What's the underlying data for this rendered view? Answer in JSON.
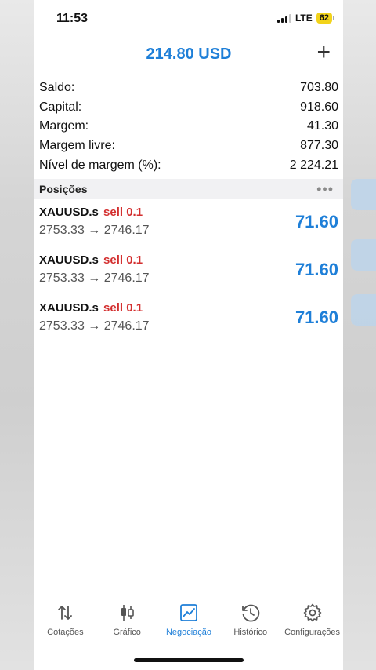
{
  "status_bar": {
    "time": "11:53",
    "network": "LTE",
    "battery": "62"
  },
  "header": {
    "title": "214.80 USD",
    "add_label": "+"
  },
  "summary": [
    {
      "label": "Saldo:",
      "value": "703.80"
    },
    {
      "label": "Capital:",
      "value": "918.60"
    },
    {
      "label": "Margem:",
      "value": "41.30"
    },
    {
      "label": "Margem livre:",
      "value": "877.30"
    },
    {
      "label": "Nível de margem (%):",
      "value": "2 224.21"
    }
  ],
  "positions_section": {
    "title": "Posições",
    "menu": "•••"
  },
  "positions": [
    {
      "symbol": "XAUUSD.s",
      "side": "sell 0.1",
      "prices": "2753.33 → 2746.17",
      "profit": "71.60"
    },
    {
      "symbol": "XAUUSD.s",
      "side": "sell 0.1",
      "prices": "2753.33 → 2746.17",
      "profit": "71.60"
    },
    {
      "symbol": "XAUUSD.s",
      "side": "sell 0.1",
      "prices": "2753.33 → 2746.17",
      "profit": "71.60"
    }
  ],
  "tabs": [
    {
      "label": "Cotações",
      "icon": "quotes-arrows-icon",
      "active": false
    },
    {
      "label": "Gráfico",
      "icon": "candlestick-chart-icon",
      "active": false
    },
    {
      "label": "Negociação",
      "icon": "trade-chart-icon",
      "active": true
    },
    {
      "label": "Histórico",
      "icon": "history-clock-icon",
      "active": false
    },
    {
      "label": "Configurações",
      "icon": "settings-gear-icon",
      "active": false
    }
  ],
  "colors": {
    "accent": "#1e7fd8",
    "sell": "#d32f2f",
    "battery": "#f2d31a"
  }
}
